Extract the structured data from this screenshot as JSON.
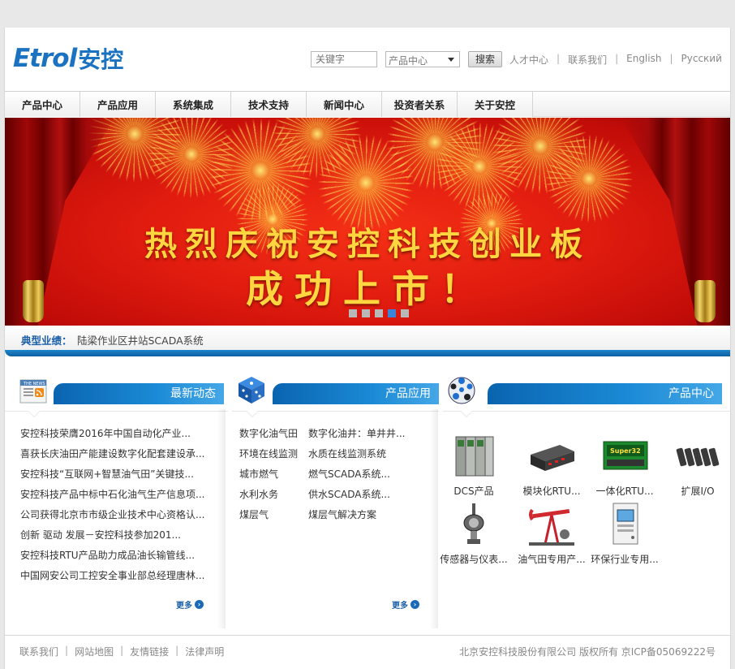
{
  "brand": {
    "logo_en": "Etrol",
    "logo_cn": "安控",
    "color": "#1a72c0"
  },
  "search": {
    "placeholder": "关键字",
    "scope_selected": "产品中心",
    "button": "搜索"
  },
  "top_links": [
    "人才中心",
    "联系我们",
    "English",
    "Русский"
  ],
  "nav": [
    "产品中心",
    "产品应用",
    "系统集成",
    "技术支持",
    "新闻中心",
    "投资者关系",
    "关于安控"
  ],
  "banner": {
    "line1": "热烈庆祝安控科技创业板",
    "line2": "成功上市！",
    "slides": 5,
    "active_slide": 4
  },
  "ticker": {
    "label": "典型业绩：",
    "text": "陆梁作业区井站SCADA系统"
  },
  "news": {
    "title": "最新动态",
    "items": [
      "安控科技荣膺2016年中国自动化产业...",
      "喜获长庆油田产能建设数字化配套建设承...",
      "安控科技“互联网+智慧油气田”关键技...",
      "安控科技产品中标中石化油气生产信息项...",
      "公司获得北京市市级企业技术中心资格认...",
      "创新  驱动  发展－安控科技参加201...",
      "安控科技RTU产品助力成品油长输管线...",
      "中国网安公司工控安全事业部总经理唐林..."
    ],
    "more": "更多"
  },
  "applications": {
    "title": "产品应用",
    "rows": [
      [
        "数字化油气田",
        "数字化油井：单井井..."
      ],
      [
        "环境在线监测",
        "水质在线监测系统"
      ],
      [
        "城市燃气",
        "燃气SCADA系统..."
      ],
      [
        "水利水务",
        "供水SCADA系统..."
      ],
      [
        "煤层气",
        "煤层气解决方案"
      ]
    ],
    "more": "更多"
  },
  "products": {
    "title": "产品中心",
    "items": [
      {
        "label": "DCS产品",
        "icon": "dcs-module-icon"
      },
      {
        "label": "模块化RTU...",
        "icon": "rtu-module-icon"
      },
      {
        "label": "一体化RTU...",
        "icon": "super32-rtu-icon"
      },
      {
        "label": "扩展I/O",
        "icon": "io-module-icon"
      },
      {
        "label": "传感器与仪表...",
        "icon": "sensor-icon"
      },
      {
        "label": "油气田专用产...",
        "icon": "pumpjack-icon"
      },
      {
        "label": "环保行业专用...",
        "icon": "cabinet-icon"
      }
    ],
    "super_label": "Super32"
  },
  "footer": {
    "links": [
      "联系我们",
      "网站地图",
      "友情链接",
      "法律声明"
    ],
    "copyright": "北京安控科技股份有限公司  版权所有  京ICP备05069222号"
  }
}
